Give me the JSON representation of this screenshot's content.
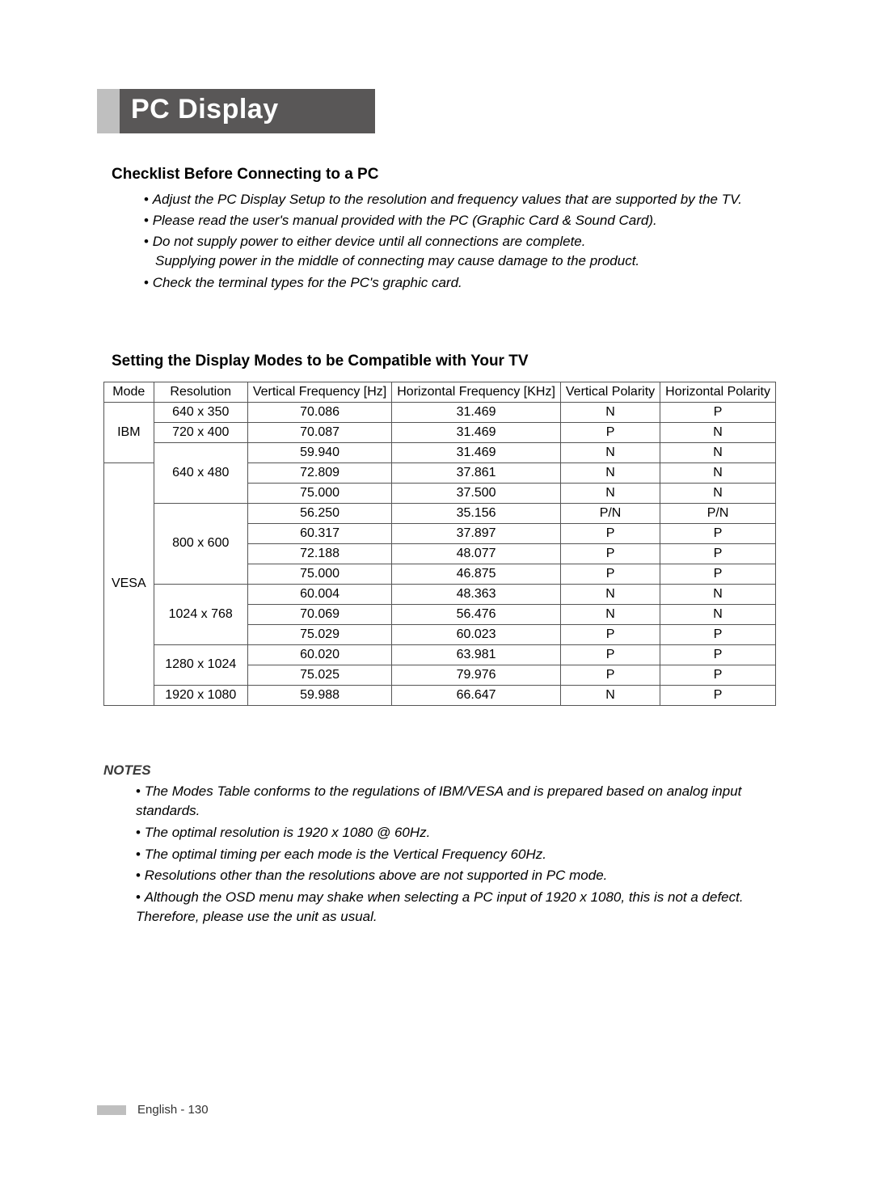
{
  "title": "PC Display",
  "section1": {
    "heading": "Checklist Before Connecting to a PC",
    "items": [
      "Adjust the PC Display Setup to the resolution and frequency values that are supported by the TV.",
      "Please read the user's manual provided with the PC (Graphic Card & Sound Card).",
      "Do not supply power to either device until all connections are complete.\nSupplying power in the middle of connecting may cause damage to the product.",
      "Check the terminal types for the PC's graphic card."
    ]
  },
  "section2": {
    "heading": "Setting the Display Modes to be Compatible with Your TV",
    "headers": [
      "Mode",
      "Resolution",
      "Vertical Frequency [Hz]",
      "Horizontal Frequency [KHz]",
      "Vertical Polarity",
      "Horizontal Polarity"
    ],
    "groups": [
      {
        "mode": "IBM",
        "resolutions": [
          {
            "res": "640 x 350",
            "rows": [
              {
                "vf": "70.086",
                "hf": "31.469",
                "vp": "N",
                "hp": "P"
              }
            ]
          },
          {
            "res": "720 x 400",
            "rows": [
              {
                "vf": "70.087",
                "hf": "31.469",
                "vp": "P",
                "hp": "N"
              }
            ]
          },
          {
            "res": "640 x 480",
            "shared_with_next_group": true,
            "rows": [
              {
                "vf": "59.940",
                "hf": "31.469",
                "vp": "N",
                "hp": "N"
              }
            ]
          }
        ]
      },
      {
        "mode": "VESA",
        "resolutions": [
          {
            "res": "640 x 480",
            "continued": true,
            "rows": [
              {
                "vf": "72.809",
                "hf": "37.861",
                "vp": "N",
                "hp": "N"
              },
              {
                "vf": "75.000",
                "hf": "37.500",
                "vp": "N",
                "hp": "N"
              }
            ]
          },
          {
            "res": "800 x 600",
            "rows": [
              {
                "vf": "56.250",
                "hf": "35.156",
                "vp": "P/N",
                "hp": "P/N"
              },
              {
                "vf": "60.317",
                "hf": "37.897",
                "vp": "P",
                "hp": "P"
              },
              {
                "vf": "72.188",
                "hf": "48.077",
                "vp": "P",
                "hp": "P"
              },
              {
                "vf": "75.000",
                "hf": "46.875",
                "vp": "P",
                "hp": "P"
              }
            ]
          },
          {
            "res": "1024 x 768",
            "rows": [
              {
                "vf": "60.004",
                "hf": "48.363",
                "vp": "N",
                "hp": "N"
              },
              {
                "vf": "70.069",
                "hf": "56.476",
                "vp": "N",
                "hp": "N"
              },
              {
                "vf": "75.029",
                "hf": "60.023",
                "vp": "P",
                "hp": "P"
              }
            ]
          },
          {
            "res": "1280 x 1024",
            "rows": [
              {
                "vf": "60.020",
                "hf": "63.981",
                "vp": "P",
                "hp": "P"
              },
              {
                "vf": "75.025",
                "hf": "79.976",
                "vp": "P",
                "hp": "P"
              }
            ]
          },
          {
            "res": "1920 x 1080",
            "rows": [
              {
                "vf": "59.988",
                "hf": "66.647",
                "vp": "N",
                "hp": "P"
              }
            ]
          }
        ]
      }
    ]
  },
  "notes": {
    "heading": "NOTES",
    "items": [
      "The Modes Table conforms to the regulations of IBM/VESA and is prepared based on analog input standards.",
      "The optimal resolution is 1920 x 1080 @ 60Hz.",
      "The optimal timing per each mode is the Vertical Frequency 60Hz.",
      "Resolutions other than the resolutions above are not supported in PC mode.",
      "Although the OSD menu may shake when selecting a PC input of 1920 x 1080, this is not a defect. Therefore, please use the unit as usual."
    ]
  },
  "footer": "English - 130"
}
